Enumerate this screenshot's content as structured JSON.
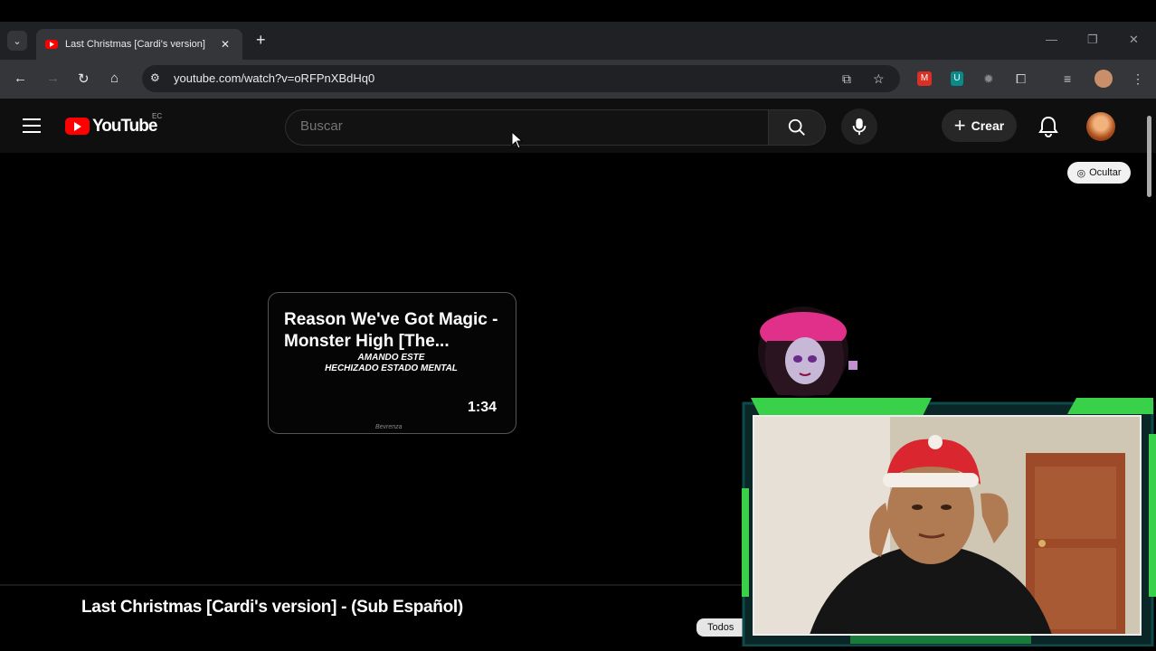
{
  "browser": {
    "tab_title": "Last Christmas [Cardi's version]",
    "url": "youtube.com/watch?v=oRFPnXBdHq0",
    "new_tab_symbol": "+",
    "close_symbol": "✕",
    "window_controls": [
      "—",
      "❐",
      "✕"
    ]
  },
  "youtube": {
    "logo_text": "YouTube",
    "country_code": "EC",
    "search_placeholder": "Buscar",
    "create_label": "Crear",
    "hide_label": "Ocultar"
  },
  "card": {
    "title": "Reason We've Got Magic - Monster High [The...",
    "subtitle_line1": "AMANDO ESTE",
    "subtitle_line2": "HECHIZADO ESTADO MENTAL",
    "duration": "1:34",
    "watermark": "Bevrenza"
  },
  "video": {
    "title": "Last Christmas [Cardi's version] - (Sub Español)",
    "chip_label": "Todos"
  },
  "colors": {
    "yt_red": "#ff0000",
    "webcam_border": "#22c55e",
    "chrome_dark": "#202124"
  }
}
